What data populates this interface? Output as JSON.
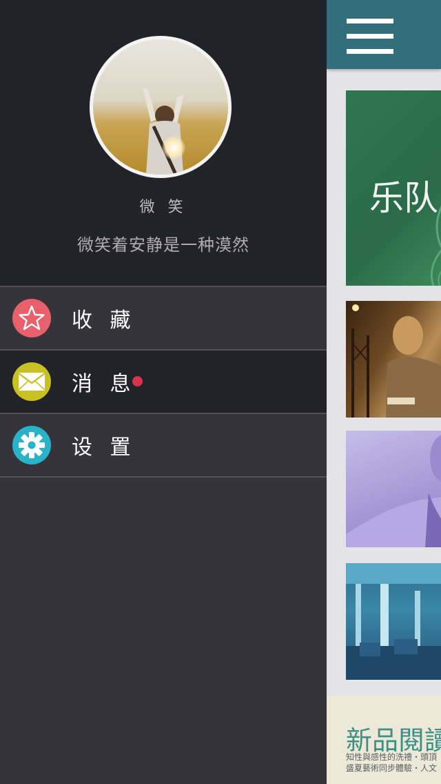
{
  "profile": {
    "avatar_icon": "avatar-photo",
    "username": "微 笑",
    "signature": "微笑着安静是一种漠然"
  },
  "menu": {
    "items": [
      {
        "label": "收 藏",
        "icon": "star-icon",
        "icon_color": "#e8606b"
      },
      {
        "label": "消 息",
        "icon": "mail-icon",
        "icon_color": "#c9c023",
        "badge_color": "#d8344f"
      },
      {
        "label": "设 置",
        "icon": "gear-icon",
        "icon_color": "#29b3c9"
      }
    ]
  },
  "main": {
    "topbar_color": "#336e7c",
    "menu_button_icon": "hamburger-icon",
    "cards": [
      {
        "title": "乐队"
      }
    ],
    "promo": {
      "title": "新品閱讀",
      "line1": "知性與感性的洗禮・頭頂",
      "line2": "盛夏藝術同步體驗・人文"
    }
  },
  "colors": {
    "drawer_bg": "#35343a",
    "profile_bg": "#222329",
    "content_bg": "#e4e4e6"
  }
}
